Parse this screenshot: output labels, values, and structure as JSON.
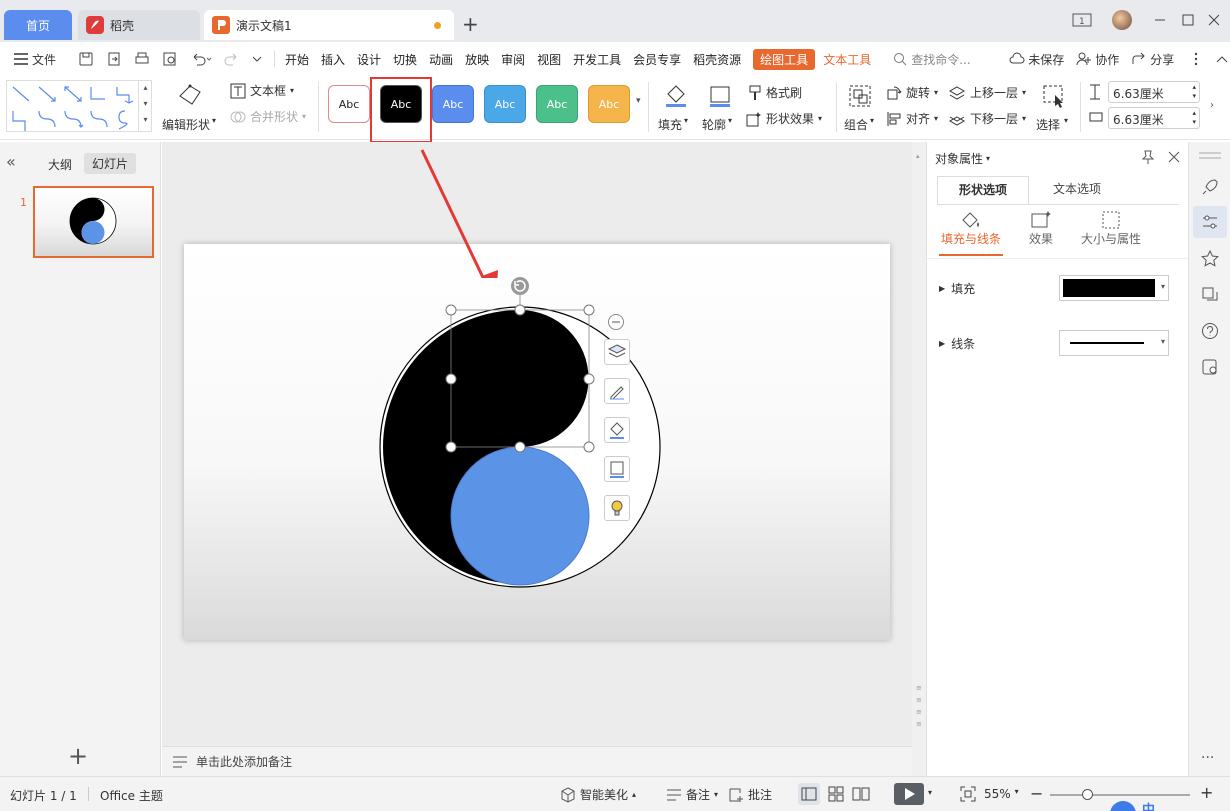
{
  "tabs": {
    "home": "首页",
    "docer": "稻壳",
    "document": "演示文稿1",
    "new_tab": "+"
  },
  "menu": {
    "file": "文件",
    "items": [
      "开始",
      "插入",
      "设计",
      "切换",
      "动画",
      "放映",
      "审阅",
      "视图",
      "开发工具",
      "会员专享",
      "稻壳资源"
    ],
    "drawing_tools": "绘图工具",
    "text_tools": "文本工具",
    "search_placeholder": "查找命令...",
    "unsaved": "未保存",
    "collaborate": "协作",
    "share": "分享"
  },
  "ribbon": {
    "edit_shape": "编辑形状",
    "text_box": "文本框",
    "merge_shape": "合并形状",
    "style_label": "Abc",
    "fill": "填充",
    "outline": "轮廓",
    "format_painter": "格式刷",
    "shape_effects": "形状效果",
    "group": "组合",
    "rotate": "旋转",
    "align": "对齐",
    "bring_forward": "上移一层",
    "send_backward": "下移一层",
    "select": "选择",
    "height": "6.63厘米",
    "width": "6.63厘米"
  },
  "left_panel": {
    "collapse": "«",
    "outline_tab": "大纲",
    "slides_tab": "幻灯片",
    "slide_number": "1",
    "add_slide": "+"
  },
  "notes_placeholder": "单击此处添加备注",
  "properties": {
    "title": "对象属性",
    "tab_shape": "形状选项",
    "tab_text": "文本选项",
    "sub_fill_line": "填充与线条",
    "sub_effects": "效果",
    "sub_size": "大小与属性",
    "fill_label": "填充",
    "line_label": "线条"
  },
  "status": {
    "slide_info": "幻灯片 1 / 1",
    "theme": "Office 主题",
    "smart_beautify": "智能美化",
    "notes": "备注",
    "comments": "批注",
    "zoom": "55%",
    "zoom_minus": "−",
    "zoom_plus": "+",
    "ime": "中"
  },
  "colors": {
    "accent": "#5b8def",
    "drawing_tools_bg": "#e8692f",
    "highlight_red": "#e53935",
    "blue_circle": "#5b93e6",
    "style_colors": [
      "#ffffff",
      "#000000",
      "#5b8def",
      "#4aa8e8",
      "#4cc08a",
      "#f5b54a"
    ]
  }
}
